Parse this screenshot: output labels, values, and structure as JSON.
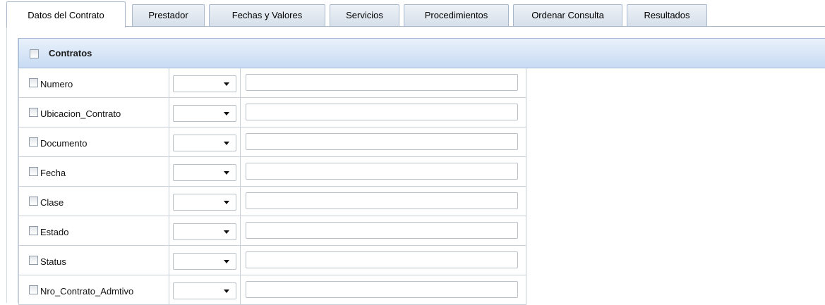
{
  "tabs": [
    {
      "label": "Datos del Contrato",
      "active": true
    },
    {
      "label": "Prestador",
      "active": false
    },
    {
      "label": "Fechas y Valores",
      "active": false
    },
    {
      "label": "Servicios",
      "active": false
    },
    {
      "label": "Procedimientos",
      "active": false
    },
    {
      "label": "Ordenar Consulta",
      "active": false
    },
    {
      "label": "Resultados",
      "active": false
    }
  ],
  "section": {
    "title": "Contratos",
    "checked": false
  },
  "fields": [
    {
      "label": "Numero",
      "operator": "",
      "value": ""
    },
    {
      "label": "Ubicacion_Contrato",
      "operator": "",
      "value": ""
    },
    {
      "label": "Documento",
      "operator": "",
      "value": ""
    },
    {
      "label": "Fecha",
      "operator": "",
      "value": ""
    },
    {
      "label": "Clase",
      "operator": "",
      "value": ""
    },
    {
      "label": "Estado",
      "operator": "",
      "value": ""
    },
    {
      "label": "Status",
      "operator": "",
      "value": ""
    },
    {
      "label": "Nro_Contrato_Admtivo",
      "operator": "",
      "value": ""
    }
  ],
  "icons": {
    "dropdown": "chevron-down-icon",
    "checkbox": "checkbox-icon"
  },
  "colors": {
    "header_bg": "#c7dbf3",
    "border": "#a8b7cc"
  }
}
